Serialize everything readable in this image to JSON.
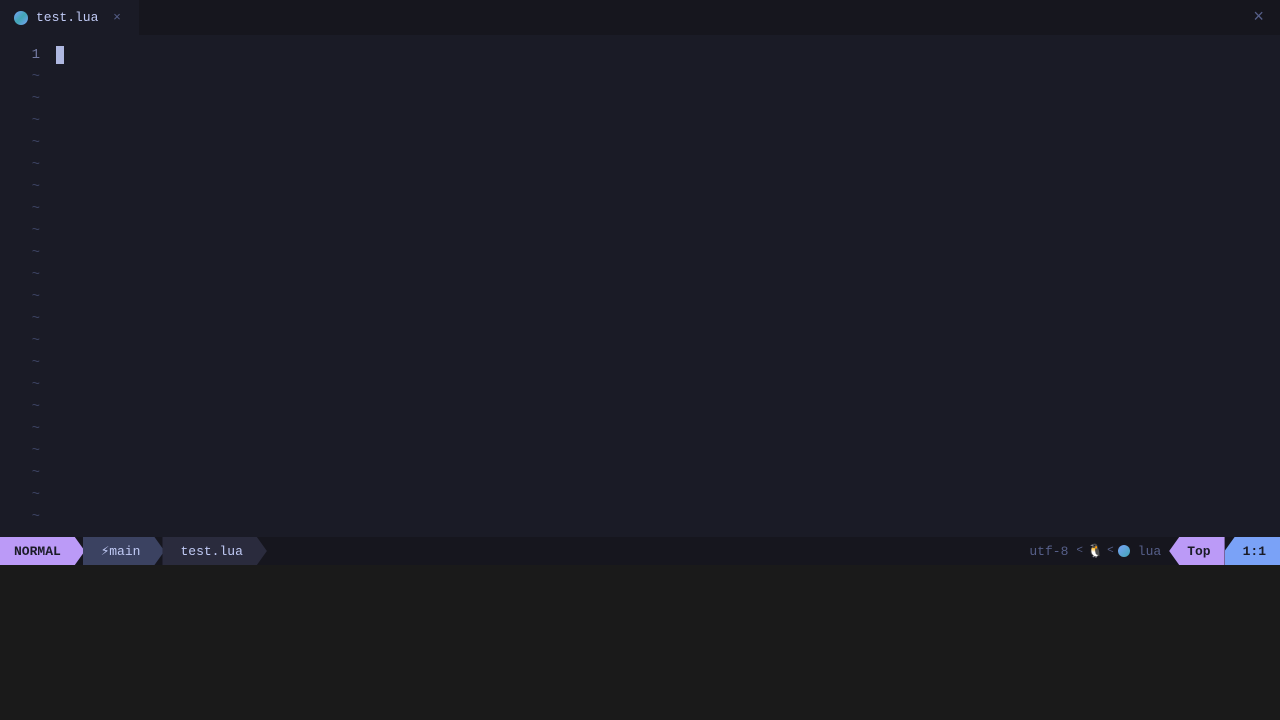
{
  "window": {
    "title": "test.lua",
    "close_label": "×"
  },
  "tab": {
    "label": "test.lua",
    "close_label": "×"
  },
  "editor": {
    "lines": [
      {
        "number": "1",
        "active": true,
        "has_cursor": true,
        "content": ""
      },
      {
        "number": "",
        "is_tilde": true
      },
      {
        "number": "",
        "is_tilde": true
      },
      {
        "number": "",
        "is_tilde": true
      },
      {
        "number": "",
        "is_tilde": true
      },
      {
        "number": "",
        "is_tilde": true
      },
      {
        "number": "",
        "is_tilde": true
      },
      {
        "number": "",
        "is_tilde": true
      },
      {
        "number": "",
        "is_tilde": true
      },
      {
        "number": "",
        "is_tilde": true
      },
      {
        "number": "",
        "is_tilde": true
      },
      {
        "number": "",
        "is_tilde": true
      },
      {
        "number": "",
        "is_tilde": true
      },
      {
        "number": "",
        "is_tilde": true
      },
      {
        "number": "",
        "is_tilde": true
      },
      {
        "number": "",
        "is_tilde": true
      },
      {
        "number": "",
        "is_tilde": true
      },
      {
        "number": "",
        "is_tilde": true
      },
      {
        "number": "",
        "is_tilde": true
      },
      {
        "number": "",
        "is_tilde": true
      },
      {
        "number": "",
        "is_tilde": true
      },
      {
        "number": "",
        "is_tilde": true
      }
    ]
  },
  "statusbar": {
    "mode": "NORMAL",
    "git_branch": "main",
    "filename": "test.lua",
    "encoding": "utf-8",
    "filetype": "lua",
    "position_top": "Top",
    "position_linenum": "1:1"
  },
  "colors": {
    "mode_bg": "#bb9af7",
    "section_bg": "#3b4261",
    "filename_bg": "#2a2b3d",
    "top_bg": "#bb9af7",
    "linenum_bg": "#7aa2f7",
    "editor_bg": "#1a1b26",
    "tabbar_bg": "#16161e"
  }
}
